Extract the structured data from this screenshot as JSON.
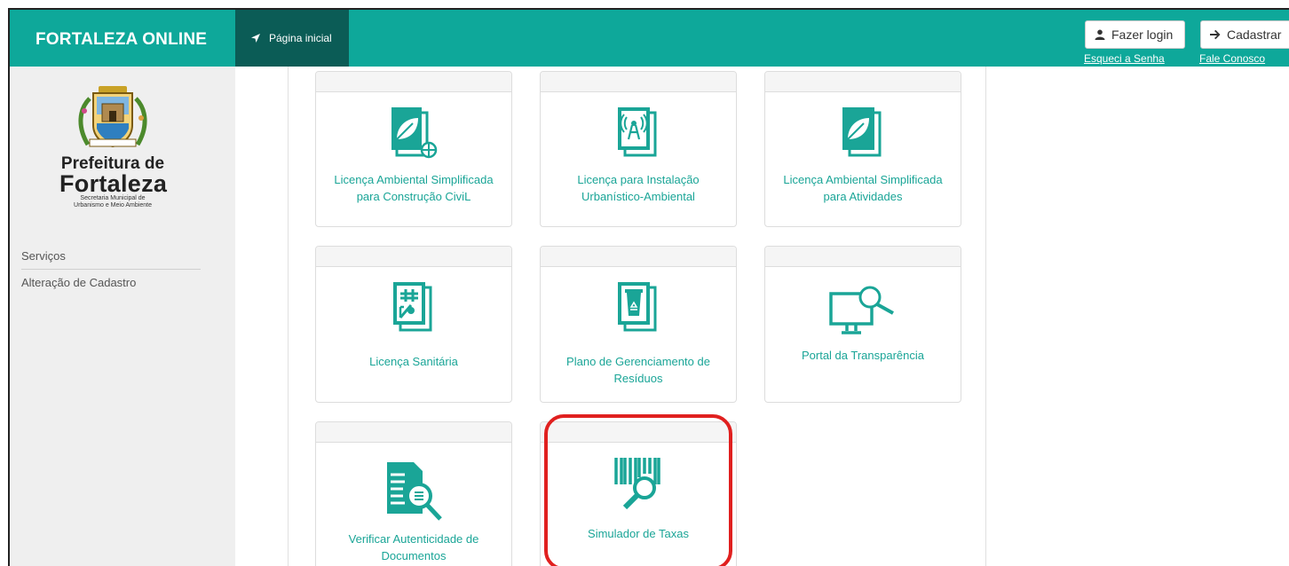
{
  "header": {
    "brand": "FORTALEZA ONLINE",
    "home_tab": "Página inicial",
    "login_button": "Fazer login",
    "register_button": "Cadastrar",
    "forgot_password_link": "Esqueci a Senha",
    "contact_link": "Fale Conosco"
  },
  "sidebar": {
    "logo": {
      "line1": "Prefeitura de",
      "line2": "Fortaleza",
      "line3": "Secretaria Municipal de",
      "line4": "Urbanismo e Meio Ambiente"
    },
    "items": [
      {
        "label": "Serviços"
      },
      {
        "label": "Alteração de Cadastro"
      }
    ]
  },
  "services": [
    {
      "label": "Licença Ambiental Simplificada para Construção CiviL",
      "icon": "leaf-document-icon"
    },
    {
      "label": "Licença para Instalação Urbanístico-Ambiental",
      "icon": "antenna-document-icon"
    },
    {
      "label": "Licença Ambiental Simplificada para Atividades",
      "icon": "leaf-document-icon"
    },
    {
      "label": "Licença Sanitária",
      "icon": "sanitary-document-icon"
    },
    {
      "label": "Plano de Gerenciamento de Resíduos",
      "icon": "recycle-document-icon"
    },
    {
      "label": "Portal da Transparência",
      "icon": "monitor-search-icon"
    },
    {
      "label": "Verificar Autenticidade de Documentos",
      "icon": "document-search-icon"
    },
    {
      "label": "Simulador de Taxas",
      "icon": "barcode-search-icon"
    }
  ],
  "colors": {
    "topbar": "#0ea89a",
    "home_tab": "#0b5c56",
    "accent_text": "#1aa597",
    "highlight": "#e0201f"
  }
}
